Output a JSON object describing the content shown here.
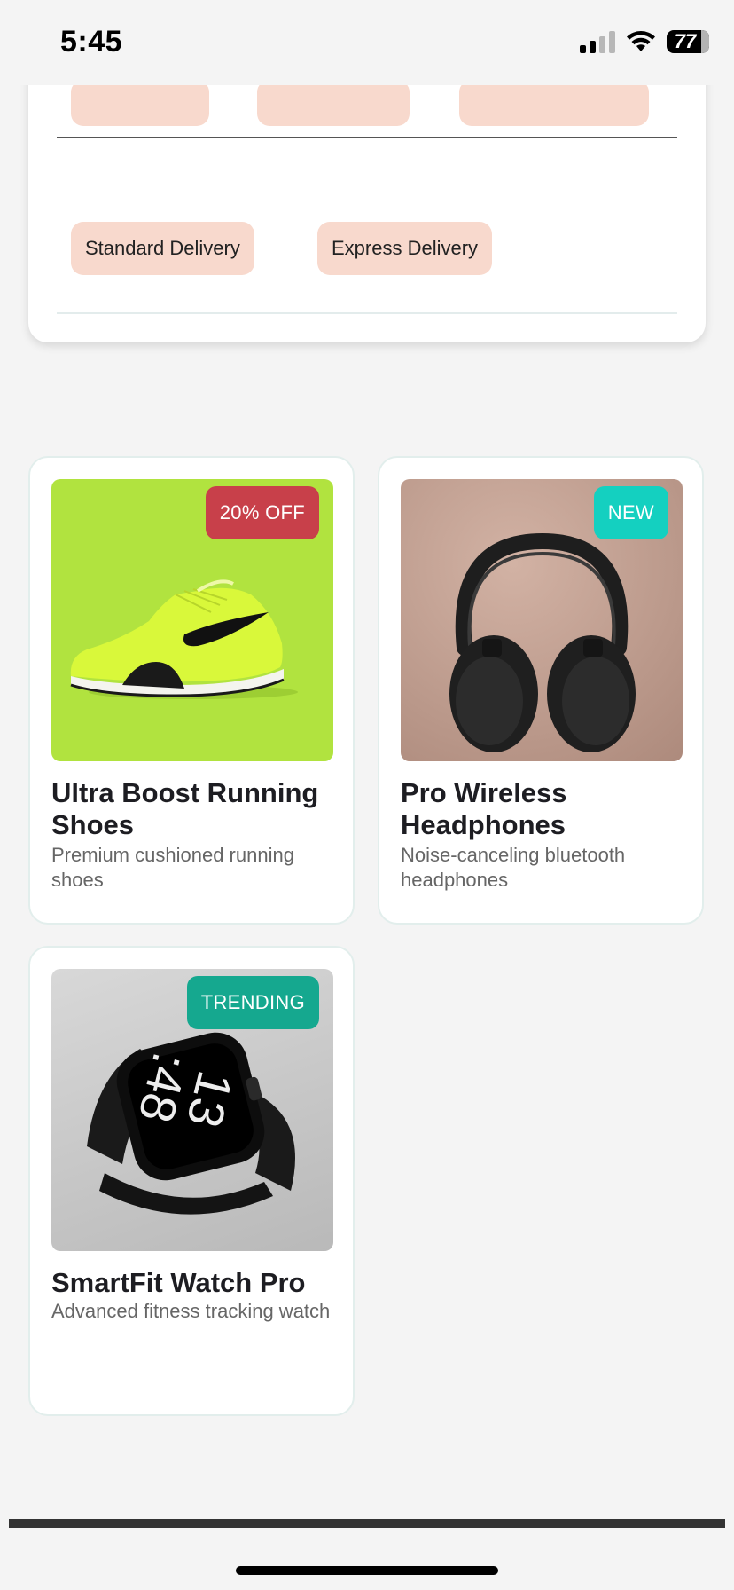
{
  "status_bar": {
    "time": "5:45",
    "battery": "77"
  },
  "delivery_options": [
    "Standard Delivery",
    "Express Delivery"
  ],
  "products": [
    {
      "title": "Ultra Boost Running Shoes",
      "description": "Premium cushioned running shoes",
      "badge": "20% OFF",
      "badge_color": "#c8404a",
      "image_bg": "#b1e33f"
    },
    {
      "title": "Pro Wireless Headphones",
      "description": "Noise-canceling bluetooth headphones",
      "badge": "NEW",
      "badge_color": "#14d0c0",
      "image_bg": "#c0a092"
    },
    {
      "title": "SmartFit Watch Pro",
      "description": "Advanced fitness tracking watch",
      "badge": "TRENDING",
      "badge_color": "#15a88f",
      "image_bg": "#d2d2d2"
    }
  ]
}
